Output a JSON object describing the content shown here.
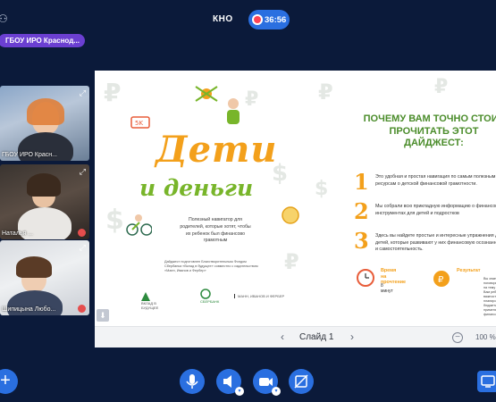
{
  "topbar": {
    "room_title": "КНО",
    "timer": "36:56"
  },
  "host_tag": "ГБОУ ИРО Краснод...",
  "participants": [
    {
      "name": "ГБОУ ИРО Красн..."
    },
    {
      "name": "Наталья ..."
    },
    {
      "name": "Шипицына Любо..."
    }
  ],
  "slide": {
    "title_line1": "Дети",
    "title_line2": "и деньги",
    "subtitle": "Полезный навигатор для родителей, которые хотят, чтобы их ребенок был финансово грамотным",
    "small_note": "Дайджест подготовлен Благотворительным Фондом Сбербанка «Вклад в будущее» совместно с издательством «Манн, Иванов и Фербер»",
    "logos": [
      "ВКЛАД В БУДУЩЕЕ",
      "СБЕРБАНК",
      "МАНН, ИВАНОВ И ФЕРБЕР"
    ],
    "right_title": "ПОЧЕМУ ВАМ ТОЧНО СТОИТ ПРОЧИТАТЬ ЭТОТ ДАЙДЖЕСТ:",
    "reasons": [
      {
        "num": "1",
        "text": "Это удобная и простая навигация по самым полезным ресурсам о детской финансовой грамотности."
      },
      {
        "num": "2",
        "text": "Мы собрали всю прикладную информацию о финансовых инструментах для детей и подростков"
      },
      {
        "num": "3",
        "text": "Здесь вы найдете простые и интересные упражнения для детей, которые развивают у них финансовую осознанность и самостоятельность."
      }
    ],
    "stats": [
      {
        "label": "Время\nна прочтение",
        "value": "8 минут"
      },
      {
        "label": "Результат",
        "value": "Вы знаете, как поговорить с ребенком на тему финансов. Вам ребенок понимает важность финансового планирования своего бюджета и умеет применять финансовые"
      }
    ]
  },
  "slide_bar": {
    "prev": "‹",
    "counter": "Слайд 1",
    "next": "›",
    "zoom": "100 %"
  },
  "toolbar": {
    "add": "+",
    "mic_icon": "microphone-icon",
    "speaker_icon": "speaker-icon",
    "camera_icon": "camera-icon",
    "screen_icon": "screen-share-off-icon",
    "chat_icon": "chat-icon"
  },
  "colors": {
    "background": "#0b1a3a",
    "accent": "#2a6fe0",
    "host_tag": "#6b3fd1",
    "orange": "#f3a01b",
    "green": "#78b52a"
  }
}
